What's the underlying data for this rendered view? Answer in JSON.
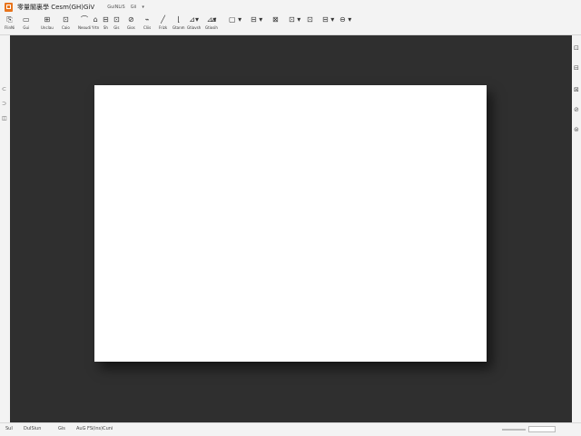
{
  "title_bar": {
    "app_icon": "presentation-app-icon",
    "title": "零量閣裏學 Cesm(GH)GiV",
    "menus": [
      "GuiNLiS",
      "Gii",
      "▾"
    ]
  },
  "toolbar": {
    "tools": [
      {
        "icon": "⎘",
        "label": "FlinNi"
      },
      {
        "icon": "▭",
        "label": "Gui"
      },
      {
        "icon": "⊞",
        "label": "Unclau"
      },
      {
        "icon": "⊡",
        "label": "Caio"
      },
      {
        "icon": "⌒",
        "label": "Neoudi"
      },
      {
        "icon": "⌂",
        "label": "Yrtn"
      },
      {
        "icon": "⊟",
        "label": "Sh"
      },
      {
        "icon": "⊡",
        "label": "Gis"
      },
      {
        "icon": "⊘",
        "label": "Gios"
      },
      {
        "icon": "⌁",
        "label": "Cliis"
      },
      {
        "icon": "╱",
        "label": "Frizk"
      },
      {
        "icon": "⌊",
        "label": "Gtanm"
      },
      {
        "icon": "⊿▾",
        "label": "Gtiavsh"
      },
      {
        "icon": "⊿▾",
        "label": "Gtiosih"
      },
      {
        "icon": "⊿",
        "label": ""
      },
      {
        "icon": "▢ ▾",
        "label": ""
      },
      {
        "icon": "⊟ ▾",
        "label": ""
      },
      {
        "icon": "⊠",
        "label": ""
      },
      {
        "icon": "⊡ ▾",
        "label": ""
      },
      {
        "icon": "⊡",
        "label": ""
      },
      {
        "icon": "⊟ ▾",
        "label": ""
      },
      {
        "icon": "⊖ ▾",
        "label": ""
      }
    ]
  },
  "left_strip": [
    "⊂",
    "⊃",
    "◫"
  ],
  "right_strip": [
    "⊡",
    "⊟",
    "⊠",
    "⊘",
    "⊜"
  ],
  "statusbar": {
    "item_1": "SuI",
    "item_2": "DuISiun",
    "item_3": "Gis",
    "item_4": "AuG FS(ins)Cuni"
  }
}
